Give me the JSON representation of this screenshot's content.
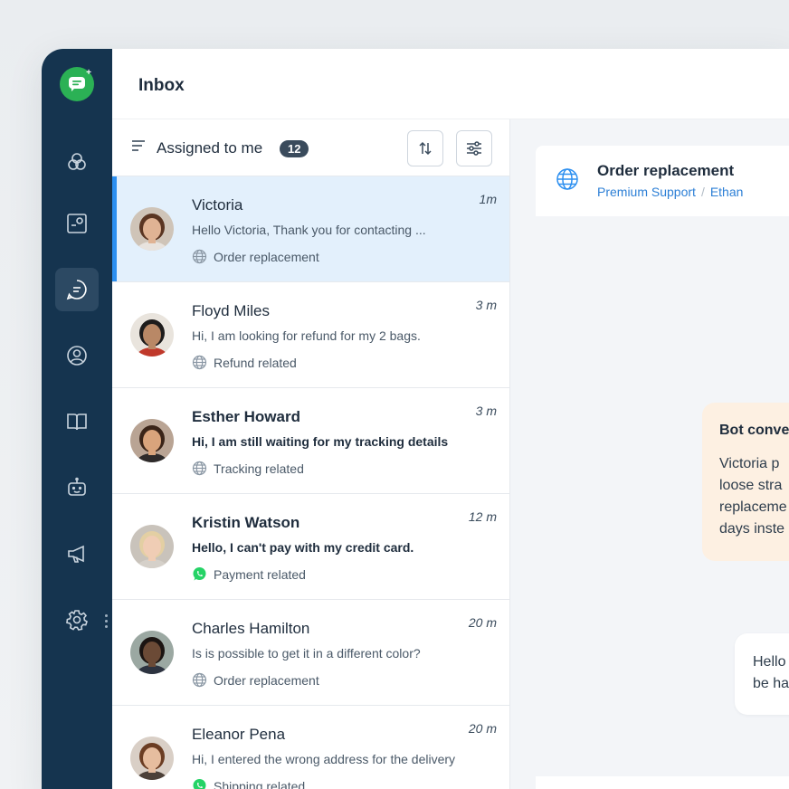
{
  "header": {
    "title": "Inbox"
  },
  "toolbar": {
    "label": "Assigned to me",
    "count": "12"
  },
  "colors": {
    "sidebar": "#15344f",
    "accent": "#2c8ff0",
    "brand": "#2bb155",
    "whatsapp": "#25d366"
  },
  "conversations": [
    {
      "name": "Victoria",
      "preview": "Hello Victoria, Thank you for contacting ...",
      "tag": "Order replacement",
      "channel": "web",
      "time": "1m",
      "unread": false,
      "active": true
    },
    {
      "name": "Floyd Miles",
      "preview": "Hi, I am looking for refund for my 2 bags.",
      "tag": "Refund related",
      "channel": "web",
      "time": "3 m",
      "unread": false,
      "active": false
    },
    {
      "name": "Esther Howard",
      "preview": "Hi, I am still waiting for my tracking details",
      "tag": "Tracking related",
      "channel": "web",
      "time": "3 m",
      "unread": true,
      "active": false
    },
    {
      "name": "Kristin Watson",
      "preview": "Hello, I can't pay with my credit card.",
      "tag": "Payment related",
      "channel": "whatsapp",
      "time": "12 m",
      "unread": true,
      "active": false
    },
    {
      "name": "Charles Hamilton",
      "preview": "Is is possible to get it in a different color?",
      "tag": "Order replacement",
      "channel": "web",
      "time": "20 m",
      "unread": false,
      "active": false
    },
    {
      "name": "Eleanor Pena",
      "preview": "Hi, I entered the wrong address for the delivery",
      "tag": "Shipping related",
      "channel": "whatsapp",
      "time": "20 m",
      "unread": false,
      "active": false
    }
  ],
  "detail": {
    "title": "Order replacement",
    "team": "Premium Support",
    "agent": "Ethan",
    "bot_title": "Bot conve",
    "bot_text": "Victoria p\nloose stra\nreplaceme\ndays inste",
    "message_text": "Hello\nbe ha"
  }
}
